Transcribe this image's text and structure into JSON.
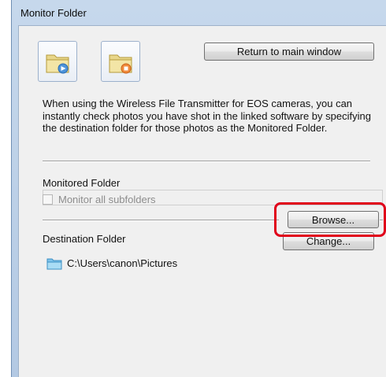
{
  "window": {
    "title": "Monitor Folder"
  },
  "toolbar": {
    "start_icon": "folder-start-icon",
    "stop_icon": "folder-stop-icon",
    "return_button": "Return to main window"
  },
  "description": "When using the Wireless File Transmitter for EOS cameras, you can instantly check photos you have shot in the linked software by specifying the destination folder for those photos as the Monitored Folder.",
  "monitored": {
    "label": "Monitored Folder",
    "value": "",
    "checkbox_label": "Monitor all subfolders",
    "checkbox_checked": false,
    "browse_button": "Browse..."
  },
  "destination": {
    "label": "Destination Folder",
    "change_button": "Change...",
    "path": "C:\\Users\\canon\\Pictures",
    "folder_icon": "folder-icon"
  },
  "colors": {
    "highlight": "#e0001a",
    "title_bar": "#c6d8ec",
    "client_bg": "#f0f0f0"
  }
}
